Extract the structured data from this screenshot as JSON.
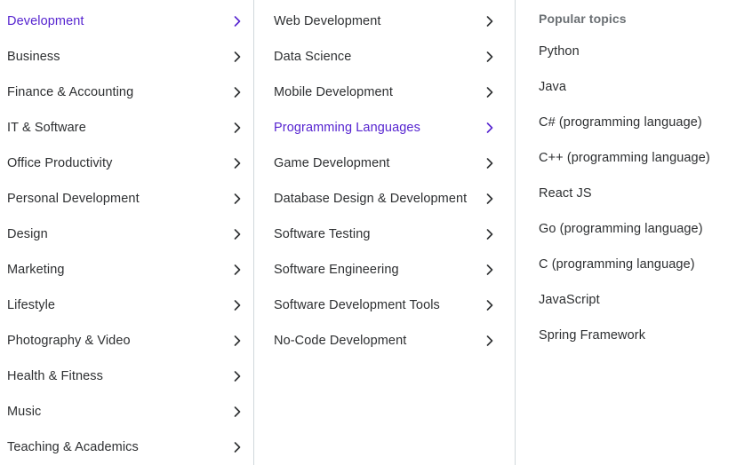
{
  "colors": {
    "brand_purple": "#5624d0",
    "text_primary": "#2d2f31",
    "text_muted": "#6a6f73",
    "divider": "#d1d7dc",
    "background": "#ffffff"
  },
  "categories": {
    "items": [
      {
        "label": "Development",
        "active": true,
        "chevron": "chevron-right-icon"
      },
      {
        "label": "Business",
        "active": false,
        "chevron": "chevron-right-icon"
      },
      {
        "label": "Finance & Accounting",
        "active": false,
        "chevron": "chevron-right-icon"
      },
      {
        "label": "IT & Software",
        "active": false,
        "chevron": "chevron-right-icon"
      },
      {
        "label": "Office Productivity",
        "active": false,
        "chevron": "chevron-right-icon"
      },
      {
        "label": "Personal Development",
        "active": false,
        "chevron": "chevron-right-icon"
      },
      {
        "label": "Design",
        "active": false,
        "chevron": "chevron-right-icon"
      },
      {
        "label": "Marketing",
        "active": false,
        "chevron": "chevron-right-icon"
      },
      {
        "label": "Lifestyle",
        "active": false,
        "chevron": "chevron-right-icon"
      },
      {
        "label": "Photography & Video",
        "active": false,
        "chevron": "chevron-right-icon"
      },
      {
        "label": "Health & Fitness",
        "active": false,
        "chevron": "chevron-right-icon"
      },
      {
        "label": "Music",
        "active": false,
        "chevron": "chevron-right-icon"
      },
      {
        "label": "Teaching & Academics",
        "active": false,
        "chevron": "chevron-right-icon"
      }
    ]
  },
  "subcategories": {
    "items": [
      {
        "label": "Web Development",
        "active": false,
        "chevron": "chevron-right-icon"
      },
      {
        "label": "Data Science",
        "active": false,
        "chevron": "chevron-right-icon"
      },
      {
        "label": "Mobile Development",
        "active": false,
        "chevron": "chevron-right-icon"
      },
      {
        "label": "Programming Languages",
        "active": true,
        "chevron": "chevron-right-icon"
      },
      {
        "label": "Game Development",
        "active": false,
        "chevron": "chevron-right-icon"
      },
      {
        "label": "Database Design & Development",
        "active": false,
        "chevron": "chevron-right-icon"
      },
      {
        "label": "Software Testing",
        "active": false,
        "chevron": "chevron-right-icon"
      },
      {
        "label": "Software Engineering",
        "active": false,
        "chevron": "chevron-right-icon"
      },
      {
        "label": "Software Development Tools",
        "active": false,
        "chevron": "chevron-right-icon"
      },
      {
        "label": "No-Code Development",
        "active": false,
        "chevron": "chevron-right-icon"
      }
    ]
  },
  "topics": {
    "heading": "Popular topics",
    "items": [
      {
        "label": "Python"
      },
      {
        "label": "Java"
      },
      {
        "label": "C# (programming language)"
      },
      {
        "label": "C++ (programming language)"
      },
      {
        "label": "React JS"
      },
      {
        "label": "Go (programming language)"
      },
      {
        "label": "C (programming language)"
      },
      {
        "label": "JavaScript"
      },
      {
        "label": "Spring Framework"
      }
    ]
  }
}
